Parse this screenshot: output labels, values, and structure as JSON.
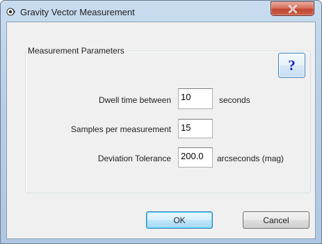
{
  "window": {
    "title": "Gravity Vector Measurement"
  },
  "group": {
    "label": "Measurement Parameters"
  },
  "help": {
    "label": "?"
  },
  "fields": [
    {
      "label": "Dwell time between",
      "value": "10",
      "unit": "seconds"
    },
    {
      "label": "Samples per measurement",
      "value": "15",
      "unit": ""
    },
    {
      "label": "Deviation Tolerance",
      "value": "200.0",
      "unit": "arcseconds (mag)"
    }
  ],
  "buttons": {
    "ok": "OK",
    "cancel": "Cancel"
  },
  "icons": {
    "app": "app-icon",
    "close": "close-icon"
  },
  "colors": {
    "close_button": "#c24632",
    "help_glyph": "#1b1fc8"
  }
}
